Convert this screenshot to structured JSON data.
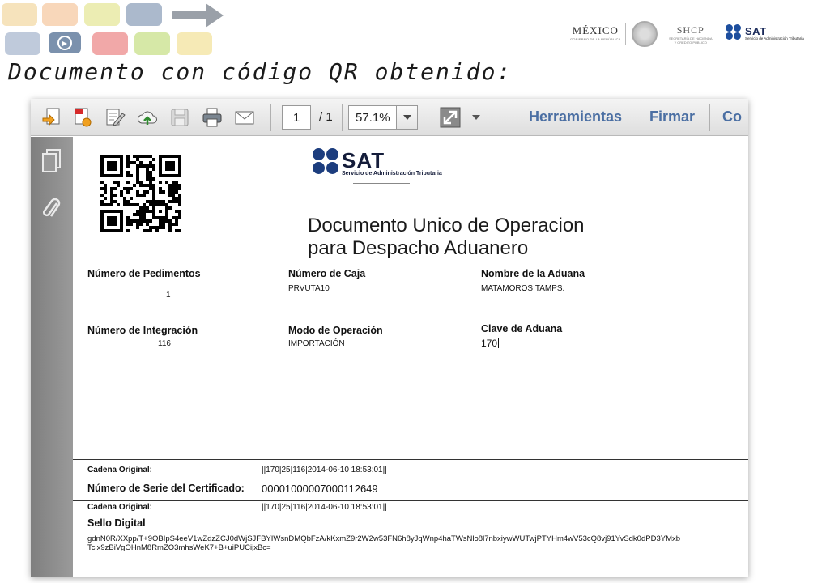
{
  "slide": {
    "title": "Documento con código QR obtenido:"
  },
  "logos": {
    "mexico": "MÉXICO",
    "mexico_sub": "GOBIERNO DE LA REPÚBLICA",
    "shcp": "SHCP",
    "shcp_sub1": "SECRETARÍA DE HACIENDA",
    "shcp_sub2": "Y CRÉDITO PÚBLICO",
    "sat": "SAT",
    "sat_sub": "Servicio de Administración Tributaria"
  },
  "toolbar": {
    "page_current": "1",
    "page_total": "/ 1",
    "zoom": "57.1%",
    "tools_label": "Herramientas",
    "sign_label": "Firmar",
    "comment_label": "Co"
  },
  "document": {
    "sat_word": "SAT",
    "sat_sub": "Servicio de Administración Tributaria",
    "title_line1": "Documento Unico de Operacion",
    "title_line2": "para Despacho Aduanero",
    "fields": {
      "pedimentos_label": "Número de Pedimentos",
      "pedimentos_value": "1",
      "caja_label": "Número de Caja",
      "caja_value": "PRVUTA10",
      "aduana_label": "Nombre de la Aduana",
      "aduana_value": "MATAMOROS,TAMPS.",
      "integracion_label": "Número de Integración",
      "integracion_value": "116",
      "modo_label": "Modo de Operación",
      "modo_value": "IMPORTACIÓN",
      "clave_label": "Clave de Aduana",
      "clave_value": "170"
    },
    "footer": {
      "cadena_label": "Cadena Original:",
      "cadena_value": "||170|25|116|2014-06-10 18:53:01||",
      "serie_label": "Número de Serie del Certificado:",
      "serie_value": "00001000007000112649",
      "cadena2_label": "Cadena Original:",
      "cadena2_value": "||170|25|116|2014-06-10 18:53:01||",
      "sello_label": "Sello Digital",
      "sello_line1": "gdnN0R/XXpp/T+9OBIpS4eeV1wZdzZCJ0dWjSJFBYIWsnDMQbFzA/kKxmZ9r2W2w53FN6h8yJqWnp4haTWsNlo8l7nbxiywWUTwjPTYHm4wV53cQ8vj91YvSdk0dPD3YMxb",
      "sello_line2": "Tcjx9zBiVgOHnM8RmZO3mhsWeK7+B+uiPUCijxBc="
    }
  },
  "colors": {
    "link_blue": "#4b6fa3",
    "sat_blue": "#1c3d7e"
  }
}
